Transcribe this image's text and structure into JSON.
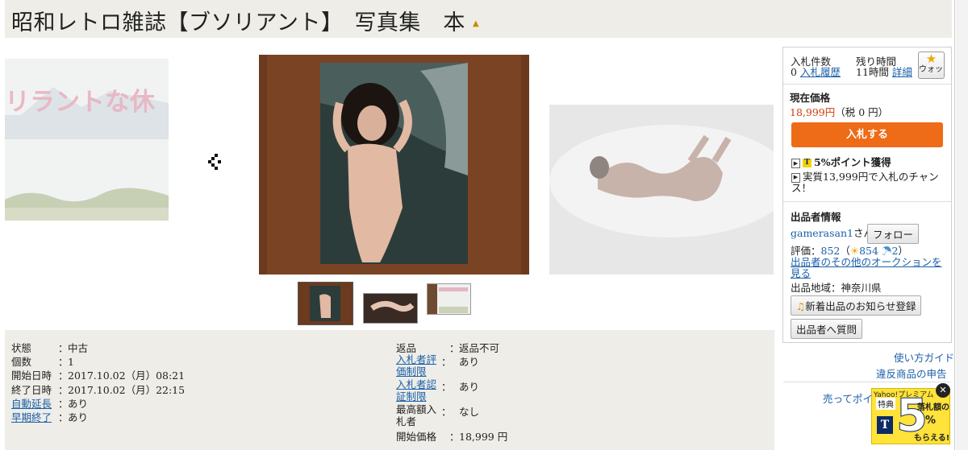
{
  "header": {
    "title": "昭和レトロ雑誌【ブソリアント】　写真集　本"
  },
  "gallery": {
    "prev_image_text": "リラントな休"
  },
  "info": {
    "left": [
      {
        "label": "状態",
        "value": "中古",
        "link": false
      },
      {
        "label": "個数",
        "value": "1",
        "link": false
      },
      {
        "label": "開始日時",
        "value": "2017.10.02（月）08:21",
        "link": false
      },
      {
        "label": "終了日時",
        "value": "2017.10.02（月）22:15",
        "link": false
      },
      {
        "label": "自動延長",
        "value": "あり",
        "link": true
      },
      {
        "label": "早期終了",
        "value": "あり",
        "link": true
      }
    ],
    "right": [
      {
        "label": "返品",
        "value": "返品不可",
        "link": false
      },
      {
        "label": "入札者評価制限",
        "value": "あり",
        "link": true
      },
      {
        "label": "入札者認証制限",
        "value": "あり",
        "link": true
      },
      {
        "label": "最高額入札者",
        "value": "なし",
        "link": false
      },
      {
        "label": "開始価格",
        "value": "18,999 円",
        "link": false
      }
    ]
  },
  "sidebar": {
    "bid_count_label": "入札件数",
    "bid_count_value": "0",
    "bid_history_link": "入札履歴",
    "time_left_label": "残り時間",
    "time_left_value": "11時間",
    "detail_link": "詳細",
    "watch_label": "ウォッチ",
    "price_label": "現在価格",
    "price_value": "18,999円",
    "price_tax": "（税 0 円）",
    "bid_button": "入札する",
    "points_text": "5%ポイント獲得",
    "chance_text": "実質13,999円で入札のチャンス！",
    "seller_header": "出品者情報",
    "seller_name": "gamerasan1",
    "seller_suffix": "さん",
    "follow_button": "フォロー",
    "rating_label": "評価：",
    "rating_total": "852",
    "rating_good": "854",
    "rating_bad": "2",
    "other_auctions_link": "出品者のその他のオークションを見る",
    "region": "出品地域：神奈川県",
    "notify_button": "新着出品のお知らせ登録",
    "question_button": "出品者へ質問",
    "guide_link": "使い方ガイド",
    "report_link": "違反商品の申告",
    "sell_link": "売ってポイ"
  },
  "ad": {
    "line1": "Yahoo!プレミアム",
    "line2": "特典",
    "big": "5",
    "percent": "%",
    "text1": "落札額の",
    "text2": "もらえる!",
    "close": "✕"
  },
  "colors": {
    "accent_orange": "#ee6b17",
    "link_blue": "#1a5fa8",
    "price_red": "#d23a0b",
    "panel_bg": "#eeede8"
  }
}
